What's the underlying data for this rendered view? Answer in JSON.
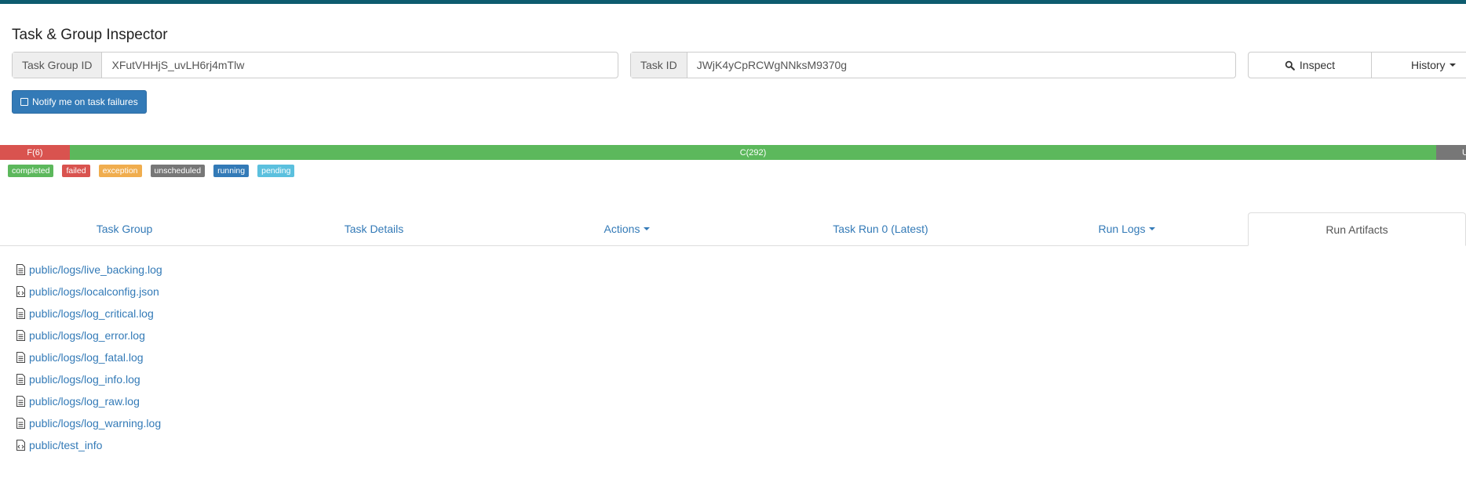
{
  "header": {
    "title": "Task & Group Inspector"
  },
  "task_group": {
    "label": "Task Group ID",
    "value": "XFutVHHjS_uvLH6rj4mTlw"
  },
  "task": {
    "label": "Task ID",
    "value": "JWjK4yCpRCWgNNksM9370g"
  },
  "toolbar": {
    "inspect_label": "Inspect",
    "history_label": "History"
  },
  "notify": {
    "label": "Notify me on task failures"
  },
  "progress": {
    "failed_label": "F(6)",
    "completed_label": "C(292)",
    "unscheduled_label": "U",
    "colors": {
      "failed": "#d9534f",
      "completed": "#5cb85c",
      "unscheduled": "#777777"
    }
  },
  "legend": [
    {
      "label": "completed",
      "color": "#5cb85c"
    },
    {
      "label": "failed",
      "color": "#d9534f"
    },
    {
      "label": "exception",
      "color": "#f0ad4e"
    },
    {
      "label": "unscheduled",
      "color": "#777777"
    },
    {
      "label": "running",
      "color": "#337ab7"
    },
    {
      "label": "pending",
      "color": "#5bc0de"
    }
  ],
  "tabs": [
    {
      "label": "Task Group"
    },
    {
      "label": "Task Details"
    },
    {
      "label": "Actions"
    },
    {
      "label": "Task Run 0 (Latest)"
    },
    {
      "label": "Run Logs"
    },
    {
      "label": "Run Artifacts",
      "active": true
    }
  ],
  "artifacts": [
    {
      "name": "public/logs/live_backing.log",
      "icon": "file-text-icon"
    },
    {
      "name": "public/logs/localconfig.json",
      "icon": "file-code-icon"
    },
    {
      "name": "public/logs/log_critical.log",
      "icon": "file-text-icon"
    },
    {
      "name": "public/logs/log_error.log",
      "icon": "file-text-icon"
    },
    {
      "name": "public/logs/log_fatal.log",
      "icon": "file-text-icon"
    },
    {
      "name": "public/logs/log_info.log",
      "icon": "file-text-icon"
    },
    {
      "name": "public/logs/log_raw.log",
      "icon": "file-text-icon"
    },
    {
      "name": "public/logs/log_warning.log",
      "icon": "file-text-icon"
    },
    {
      "name": "public/test_info",
      "icon": "file-code-icon"
    }
  ]
}
